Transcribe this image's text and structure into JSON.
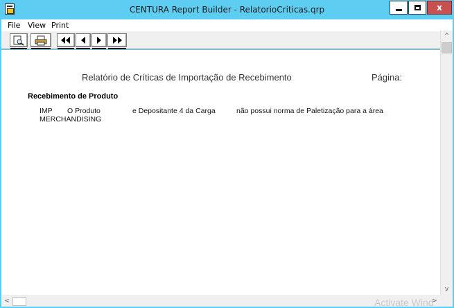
{
  "window": {
    "title": "CENTURA Report Builder - RelatorioCriticas.qrp",
    "accent_color": "#5ecdf2",
    "close_color": "#c75050"
  },
  "titlebar_buttons": {
    "minimize_icon": "minimize-icon",
    "maximize_icon": "maximize-icon",
    "close_glyph": "x"
  },
  "menu": {
    "items": [
      "File",
      "View",
      "Print"
    ]
  },
  "toolbar": {
    "buttons": [
      {
        "name": "preview-button",
        "icon": "page-preview-icon"
      },
      {
        "name": "print-button",
        "icon": "printer-icon"
      },
      {
        "name": "first-page-button",
        "glyph": "◀◀"
      },
      {
        "name": "prev-page-button",
        "glyph": "◀"
      },
      {
        "name": "next-page-button",
        "glyph": "▶"
      },
      {
        "name": "last-page-button",
        "glyph": "▶▶"
      }
    ]
  },
  "report": {
    "title": "Relatório de Críticas de Importação de Recebimento",
    "page_label": "Página:",
    "section_heading": "Recebimento de Produto",
    "row": {
      "col1": "IMP",
      "col2": "O Produto",
      "col3": "e Depositante 4 da Carga",
      "col4": "não possui norma de Paletização para a área",
      "line2": "MERCHANDISING"
    }
  },
  "scrollbars": {
    "up": "^",
    "down": "v",
    "left": "<",
    "right": ">"
  },
  "watermark": "Activate Wind"
}
